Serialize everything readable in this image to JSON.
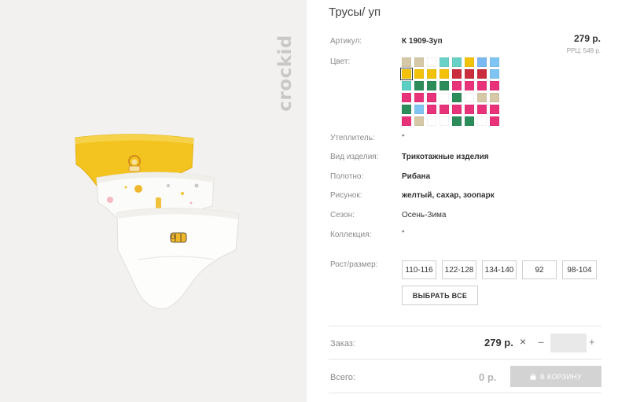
{
  "product": {
    "title": "Трусы/ уп",
    "brand": "crockid",
    "price": "279 р.",
    "rrp": "РРЦ: 549 р."
  },
  "details": {
    "article_label": "Артикул:",
    "article_value": "К 1909-3уп",
    "color_label": "Цвет:",
    "insulation_label": "Утеплитель:",
    "insulation_value": "\"",
    "type_label": "Вид изделия:",
    "type_value": "Трикотажные изделия",
    "fabric_label": "Полотно:",
    "fabric_value": "Рибана",
    "pattern_label": "Рисунок:",
    "pattern_value": "желтый, сахар, зоопарк",
    "season_label": "Сезон:",
    "season_value": "Осень-Зима",
    "collection_label": "Коллекция:",
    "collection_value": "\""
  },
  "swatch_colors": [
    "#d6c9a8",
    "#d6c9a8",
    "#ffffff",
    "#6ad1c7",
    "#6ad1c7",
    "#f2c10a",
    "#79b8f0",
    "#7fc4f2",
    "#f2c10a",
    "#f2c10a",
    "#f2c10a",
    "#f2c10a",
    "#c92d3e",
    "#c92d3e",
    "#c92d3e",
    "#7fc4f2",
    "#5ccfc4",
    "#2c8c5a",
    "#2c8c5a",
    "#2c8c5a",
    "#e8327a",
    "#e8327a",
    "#e8327a",
    "#e8327a",
    "#e8327a",
    "#e8327a",
    "#e8327a",
    "#ffffff",
    "#2c8c5a",
    "#ffffff",
    "#d6c9a8",
    "#d6c9a8",
    "#2c8c5a",
    "#7fc4f2",
    "#e8327a",
    "#e8327a",
    "#e8327a",
    "#e8327a",
    "#e8327a",
    "#e8327a",
    "#e8327a",
    "#d6c9a8",
    "#ffffff",
    "#ffffff",
    "#2c8c5a",
    "#2c8c5a",
    "#ffffff",
    "#e8327a"
  ],
  "selected_swatch": 8,
  "size": {
    "label": "Рост/размер:",
    "options": [
      "110-116",
      "122-128",
      "134-140",
      "92",
      "98-104"
    ],
    "select_all": "ВЫБРАТЬ ВСЕ"
  },
  "order": {
    "label": "Заказ:",
    "price": "279 р.",
    "remove_icon": "close-icon",
    "minus": "−",
    "plus": "+",
    "quantity": ""
  },
  "total": {
    "label": "Всего:",
    "value": "0 р.",
    "cart_button": "В КОРЗИНУ",
    "cart_icon": "shopping-bag-icon"
  }
}
